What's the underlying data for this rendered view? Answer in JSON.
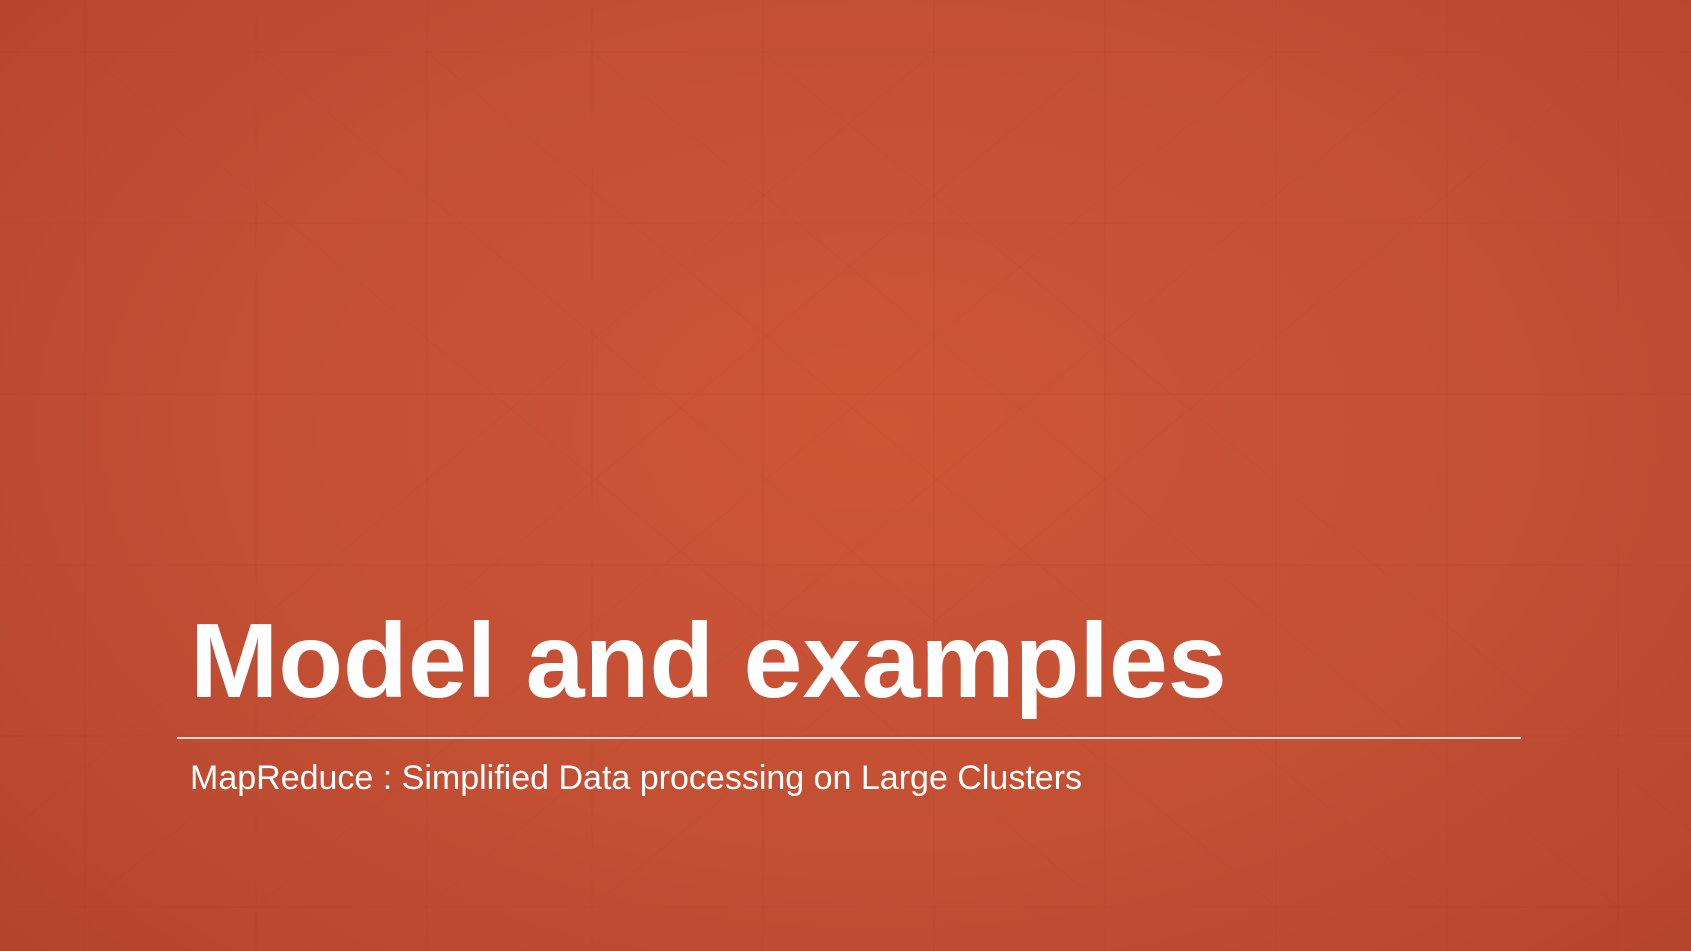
{
  "slide": {
    "title": "Model and examples",
    "subtitle": "MapReduce : Simplified Data processing on Large Clusters"
  },
  "colors": {
    "background": "#c8502f",
    "text": "#ffffff"
  }
}
